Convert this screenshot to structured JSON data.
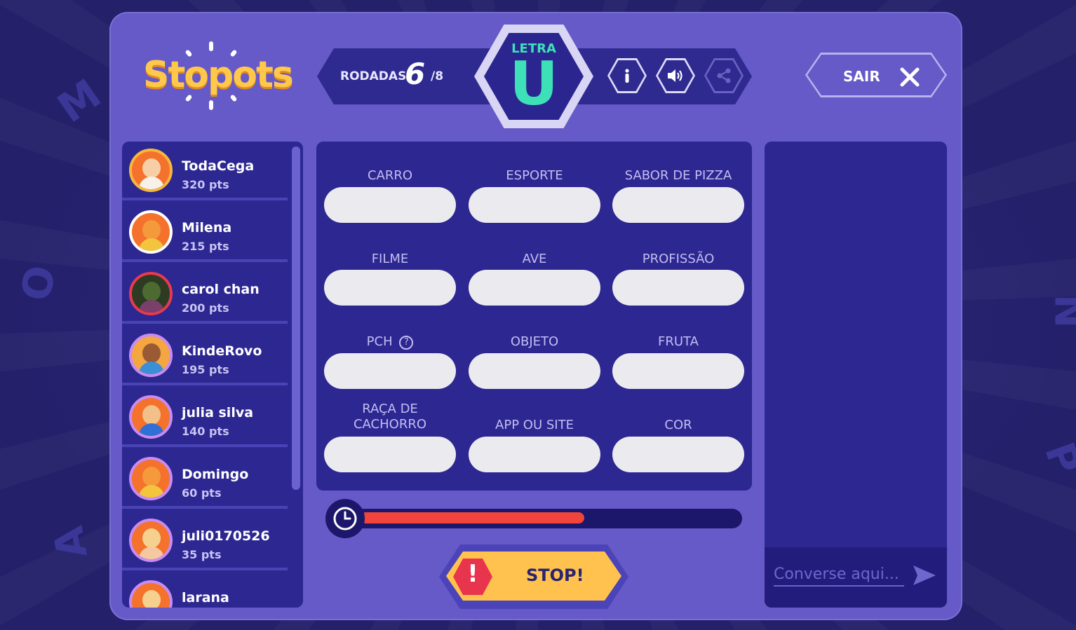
{
  "app": {
    "logo": "Stopots"
  },
  "header": {
    "rounds_label": "RODADAS",
    "rounds_current": "6",
    "rounds_total": "/8",
    "letter_label": "LETRA",
    "letter_value": "U",
    "exit_label": "SAIR"
  },
  "players": [
    {
      "name": "TodaCega",
      "points": "320 pts",
      "ring": "#f6b73c",
      "skin": "#f3b07a",
      "bg": "#f4722c"
    },
    {
      "name": "Milena",
      "points": "215 pts",
      "ring": "#ffffff",
      "skin": "#f49a3c",
      "bg": "#f4722c"
    },
    {
      "name": "carol chan",
      "points": "200 pts",
      "ring": "#e83a4e",
      "skin": "#3b4a2a",
      "bg": "#2d3b22"
    },
    {
      "name": "KindeRovo",
      "points": "195 pts",
      "ring": "#c88cf0",
      "skin": "#9a5a34",
      "bg": "#f4a640"
    },
    {
      "name": "julia silva",
      "points": "140 pts",
      "ring": "#c88cf0",
      "skin": "#f3c08a",
      "bg": "#f4722c"
    },
    {
      "name": "Domingo",
      "points": "60 pts",
      "ring": "#c88cf0",
      "skin": "#f49a3c",
      "bg": "#f4722c"
    },
    {
      "name": "juli0170526",
      "points": "35 pts",
      "ring": "#c88cf0",
      "skin": "#f6d08e",
      "bg": "#f4722c"
    },
    {
      "name": "larana",
      "points": "",
      "ring": "#c88cf0",
      "skin": "#f6d08e",
      "bg": "#f4722c"
    }
  ],
  "categories": [
    {
      "label": "CARRO",
      "value": ""
    },
    {
      "label": "ESPORTE",
      "value": ""
    },
    {
      "label": "SABOR DE PIZZA",
      "value": ""
    },
    {
      "label": "FILME",
      "value": ""
    },
    {
      "label": "AVE",
      "value": ""
    },
    {
      "label": "PROFISSÃO",
      "value": ""
    },
    {
      "label": "PCH",
      "value": "",
      "help": "?"
    },
    {
      "label": "OBJETO",
      "value": ""
    },
    {
      "label": "FRUTA",
      "value": ""
    },
    {
      "label": "RAÇA DE CACHORRO",
      "value": ""
    },
    {
      "label": "APP OU SITE",
      "value": ""
    },
    {
      "label": "COR",
      "value": ""
    }
  ],
  "timer": {
    "remaining_fraction": 0.57
  },
  "stop": {
    "label": "STOP!",
    "icon": "!"
  },
  "chat": {
    "placeholder": "Converse aqui..."
  },
  "icons": {
    "info": "info-icon",
    "sound": "speaker-icon",
    "share": "share-icon",
    "close": "close-icon",
    "clock": "clock-icon",
    "send": "send-icon"
  },
  "colors": {
    "panel": "#6659c8",
    "dark": "#2d2792",
    "accent": "#3ee0b8",
    "stop": "#ffc24e",
    "timer": "#f2443a"
  },
  "background_letters": [
    "M",
    "O",
    "A",
    "N",
    "P"
  ]
}
